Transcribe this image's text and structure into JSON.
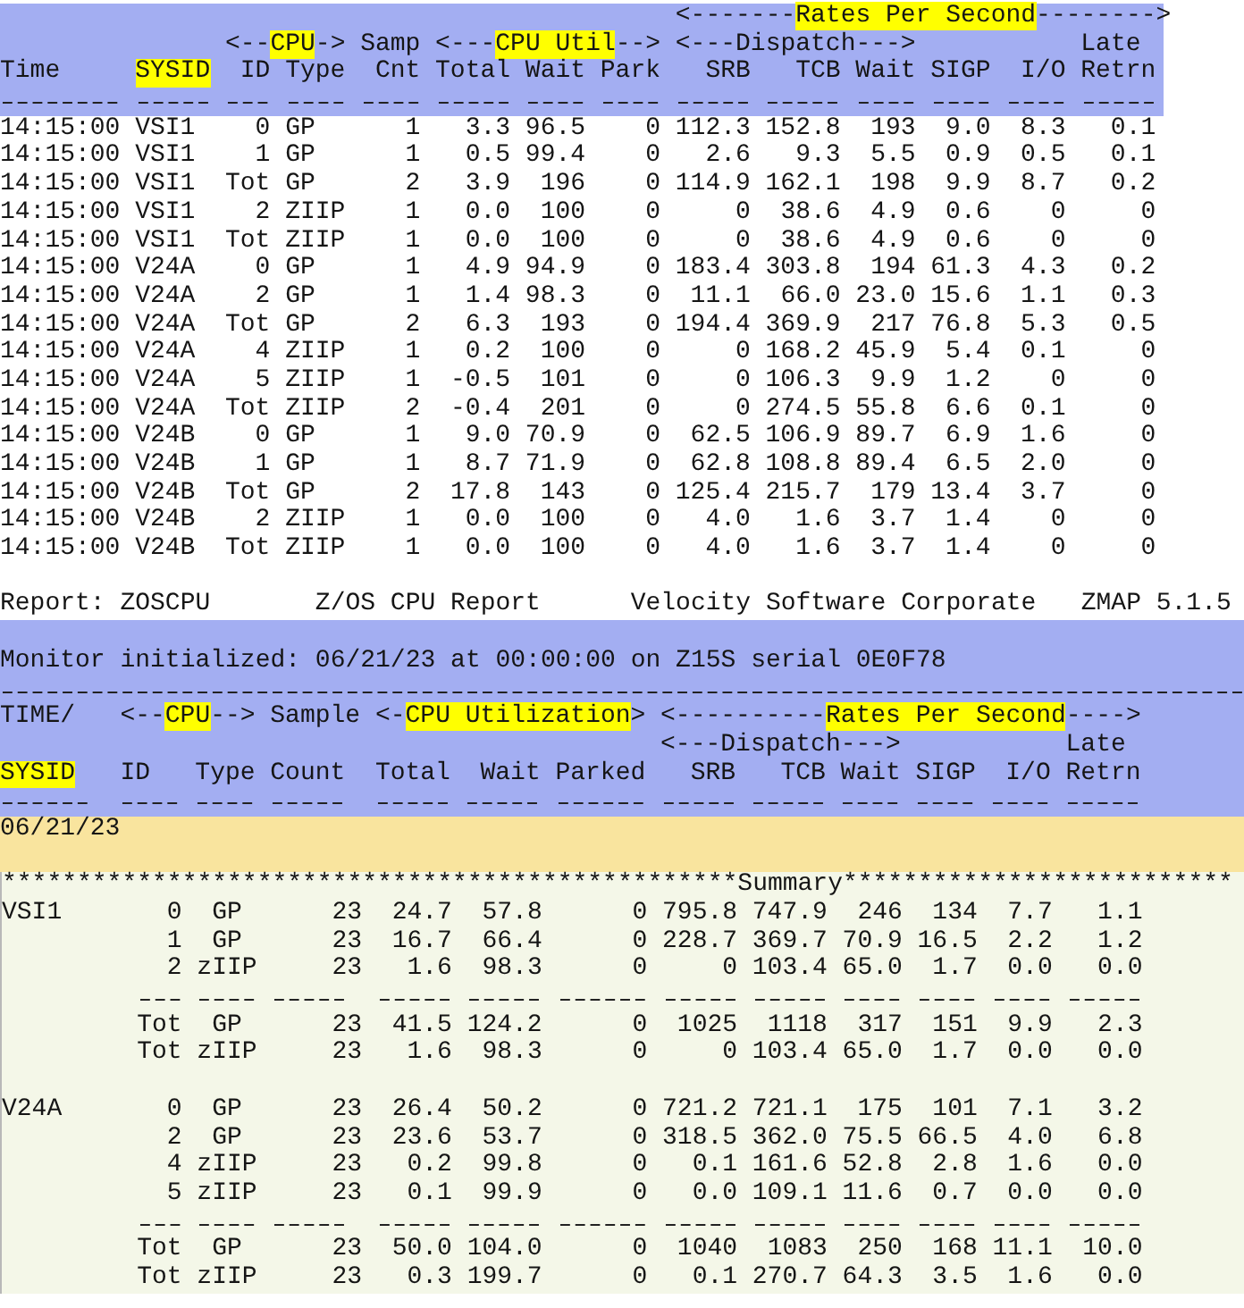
{
  "interval_table": {
    "group_headers": [
      {
        "parts": [
          {
            "text": "<-------",
            "highlight": false
          },
          {
            "text": "Rates Per Second",
            "highlight": true
          },
          {
            "text": "-------->",
            "highlight": false
          }
        ]
      }
    ],
    "subgroup_headers": [
      {
        "parts": [
          {
            "text": "<--",
            "highlight": false
          },
          {
            "text": "CPU",
            "highlight": true
          },
          {
            "text": "->",
            "highlight": false
          }
        ]
      },
      {
        "parts": [
          {
            "text": "Samp",
            "highlight": false
          }
        ]
      },
      {
        "parts": [
          {
            "text": "<---",
            "highlight": false
          },
          {
            "text": "CPU Util",
            "highlight": true
          },
          {
            "text": "-->",
            "highlight": false
          }
        ]
      },
      {
        "parts": [
          {
            "text": "<---Dispatch--->",
            "highlight": false
          }
        ]
      },
      {
        "parts": [
          {
            "text": "Late",
            "highlight": false
          }
        ]
      }
    ],
    "columns": [
      {
        "label": "Time",
        "highlight": false
      },
      {
        "label": "SYSID",
        "highlight": true
      },
      {
        "label": "ID",
        "highlight": false
      },
      {
        "label": "Type",
        "highlight": false
      },
      {
        "label": "Cnt",
        "highlight": false
      },
      {
        "label": "Total",
        "highlight": false
      },
      {
        "label": "Wait",
        "highlight": false
      },
      {
        "label": "Park",
        "highlight": false
      },
      {
        "label": "SRB",
        "highlight": false
      },
      {
        "label": "TCB",
        "highlight": false
      },
      {
        "label": "Wait",
        "highlight": false
      },
      {
        "label": "SIGP",
        "highlight": false
      },
      {
        "label": "I/O",
        "highlight": false
      },
      {
        "label": "Retrn",
        "highlight": false
      }
    ],
    "rows": [
      [
        "14:15:00",
        "VSI1",
        "0",
        "GP",
        "1",
        "3.3",
        "96.5",
        "0",
        "112.3",
        "152.8",
        "193",
        "9.0",
        "8.3",
        "0.1"
      ],
      [
        "14:15:00",
        "VSI1",
        "1",
        "GP",
        "1",
        "0.5",
        "99.4",
        "0",
        "2.6",
        "9.3",
        "5.5",
        "0.9",
        "0.5",
        "0.1"
      ],
      [
        "14:15:00",
        "VSI1",
        "Tot",
        "GP",
        "2",
        "3.9",
        "196",
        "0",
        "114.9",
        "162.1",
        "198",
        "9.9",
        "8.7",
        "0.2"
      ],
      [
        "14:15:00",
        "VSI1",
        "2",
        "ZIIP",
        "1",
        "0.0",
        "100",
        "0",
        "0",
        "38.6",
        "4.9",
        "0.6",
        "0",
        "0"
      ],
      [
        "14:15:00",
        "VSI1",
        "Tot",
        "ZIIP",
        "1",
        "0.0",
        "100",
        "0",
        "0",
        "38.6",
        "4.9",
        "0.6",
        "0",
        "0"
      ],
      [
        "14:15:00",
        "V24A",
        "0",
        "GP",
        "1",
        "4.9",
        "94.9",
        "0",
        "183.4",
        "303.8",
        "194",
        "61.3",
        "4.3",
        "0.2"
      ],
      [
        "14:15:00",
        "V24A",
        "2",
        "GP",
        "1",
        "1.4",
        "98.3",
        "0",
        "11.1",
        "66.0",
        "23.0",
        "15.6",
        "1.1",
        "0.3"
      ],
      [
        "14:15:00",
        "V24A",
        "Tot",
        "GP",
        "2",
        "6.3",
        "193",
        "0",
        "194.4",
        "369.9",
        "217",
        "76.8",
        "5.3",
        "0.5"
      ],
      [
        "14:15:00",
        "V24A",
        "4",
        "ZIIP",
        "1",
        "0.2",
        "100",
        "0",
        "0",
        "168.2",
        "45.9",
        "5.4",
        "0.1",
        "0"
      ],
      [
        "14:15:00",
        "V24A",
        "5",
        "ZIIP",
        "1",
        "-0.5",
        "101",
        "0",
        "0",
        "106.3",
        "9.9",
        "1.2",
        "0",
        "0"
      ],
      [
        "14:15:00",
        "V24A",
        "Tot",
        "ZIIP",
        "2",
        "-0.4",
        "201",
        "0",
        "0",
        "274.5",
        "55.8",
        "6.6",
        "0.1",
        "0"
      ],
      [
        "14:15:00",
        "V24B",
        "0",
        "GP",
        "1",
        "9.0",
        "70.9",
        "0",
        "62.5",
        "106.9",
        "89.7",
        "6.9",
        "1.6",
        "0"
      ],
      [
        "14:15:00",
        "V24B",
        "1",
        "GP",
        "1",
        "8.7",
        "71.9",
        "0",
        "62.8",
        "108.8",
        "89.4",
        "6.5",
        "2.0",
        "0"
      ],
      [
        "14:15:00",
        "V24B",
        "Tot",
        "GP",
        "2",
        "17.8",
        "143",
        "0",
        "125.4",
        "215.7",
        "179",
        "13.4",
        "3.7",
        "0"
      ],
      [
        "14:15:00",
        "V24B",
        "2",
        "ZIIP",
        "1",
        "0.0",
        "100",
        "0",
        "4.0",
        "1.6",
        "3.7",
        "1.4",
        "0",
        "0"
      ],
      [
        "14:15:00",
        "V24B",
        "Tot",
        "ZIIP",
        "1",
        "0.0",
        "100",
        "0",
        "4.0",
        "1.6",
        "3.7",
        "1.4",
        "0",
        "0"
      ]
    ]
  },
  "report": {
    "title_items": [
      "Report: ZOSCPU",
      "Z/OS CPU Report",
      "Velocity Software Corporate",
      "ZMAP 5.1.5"
    ],
    "monitor_line": "Monitor initialized: 06/21/23 at 00:00:00 on Z15S serial 0E0F78",
    "group_headers": [
      {
        "parts": [
          {
            "text": "TIME/",
            "highlight": false
          }
        ]
      },
      {
        "parts": [
          {
            "text": "<--",
            "highlight": false
          },
          {
            "text": "CPU",
            "highlight": true
          },
          {
            "text": "-->",
            "highlight": false
          }
        ]
      },
      {
        "parts": [
          {
            "text": "Sample",
            "highlight": false
          }
        ]
      },
      {
        "parts": [
          {
            "text": "<-",
            "highlight": false
          },
          {
            "text": "CPU Utilization",
            "highlight": true
          },
          {
            "text": ">",
            "highlight": false
          }
        ]
      },
      {
        "parts": [
          {
            "text": "<----------",
            "highlight": false
          },
          {
            "text": "Rates Per Second",
            "highlight": true
          },
          {
            "text": "---->",
            "highlight": false
          }
        ]
      }
    ],
    "subgroup_headers": [
      {
        "parts": [
          {
            "text": "<---Dispatch--->",
            "highlight": false
          }
        ]
      },
      {
        "parts": [
          {
            "text": "Late",
            "highlight": false
          }
        ]
      }
    ],
    "columns": [
      {
        "label": "SYSID",
        "highlight": true
      },
      {
        "label": "ID",
        "highlight": false
      },
      {
        "label": "Type",
        "highlight": false
      },
      {
        "label": "Count",
        "highlight": false
      },
      {
        "label": "Total",
        "highlight": false
      },
      {
        "label": "Wait",
        "highlight": false
      },
      {
        "label": "Parked",
        "highlight": false
      },
      {
        "label": "SRB",
        "highlight": false
      },
      {
        "label": "TCB",
        "highlight": false
      },
      {
        "label": "Wait",
        "highlight": false
      },
      {
        "label": "SIGP",
        "highlight": false
      },
      {
        "label": "I/O",
        "highlight": false
      },
      {
        "label": "Retrn",
        "highlight": false
      }
    ],
    "date": "06/21/23",
    "summary_banner": "*************************************************Summary**************************",
    "systems": [
      {
        "sysid": "VSI1",
        "rows": [
          [
            "0",
            "GP",
            "23",
            "24.7",
            "57.8",
            "0",
            "795.8",
            "747.9",
            "246",
            "134",
            "7.7",
            "1.1"
          ],
          [
            "1",
            "GP",
            "23",
            "16.7",
            "66.4",
            "0",
            "228.7",
            "369.7",
            "70.9",
            "16.5",
            "2.2",
            "1.2"
          ],
          [
            "2",
            "zIIP",
            "23",
            "1.6",
            "98.3",
            "0",
            "0",
            "103.4",
            "65.0",
            "1.7",
            "0.0",
            "0.0"
          ]
        ],
        "totals": [
          [
            "Tot",
            "GP",
            "23",
            "41.5",
            "124.2",
            "0",
            "1025",
            "1118",
            "317",
            "151",
            "9.9",
            "2.3"
          ],
          [
            "Tot",
            "zIIP",
            "23",
            "1.6",
            "98.3",
            "0",
            "0",
            "103.4",
            "65.0",
            "1.7",
            "0.0",
            "0.0"
          ]
        ]
      },
      {
        "sysid": "V24A",
        "rows": [
          [
            "0",
            "GP",
            "23",
            "26.4",
            "50.2",
            "0",
            "721.2",
            "721.1",
            "175",
            "101",
            "7.1",
            "3.2"
          ],
          [
            "2",
            "GP",
            "23",
            "23.6",
            "53.7",
            "0",
            "318.5",
            "362.0",
            "75.5",
            "66.5",
            "4.0",
            "6.8"
          ],
          [
            "4",
            "zIIP",
            "23",
            "0.2",
            "99.8",
            "0",
            "0.1",
            "161.6",
            "52.8",
            "2.8",
            "1.6",
            "0.0"
          ],
          [
            "5",
            "zIIP",
            "23",
            "0.1",
            "99.9",
            "0",
            "0.0",
            "109.1",
            "11.6",
            "0.7",
            "0.0",
            "0.0"
          ]
        ],
        "totals": [
          [
            "Tot",
            "GP",
            "23",
            "50.0",
            "104.0",
            "0",
            "1040",
            "1083",
            "250",
            "168",
            "11.1",
            "10.0"
          ],
          [
            "Tot",
            "zIIP",
            "23",
            "0.3",
            "199.7",
            "0",
            "0.1",
            "270.7",
            "64.3",
            "3.5",
            "1.6",
            "0.0"
          ]
        ]
      }
    ]
  }
}
